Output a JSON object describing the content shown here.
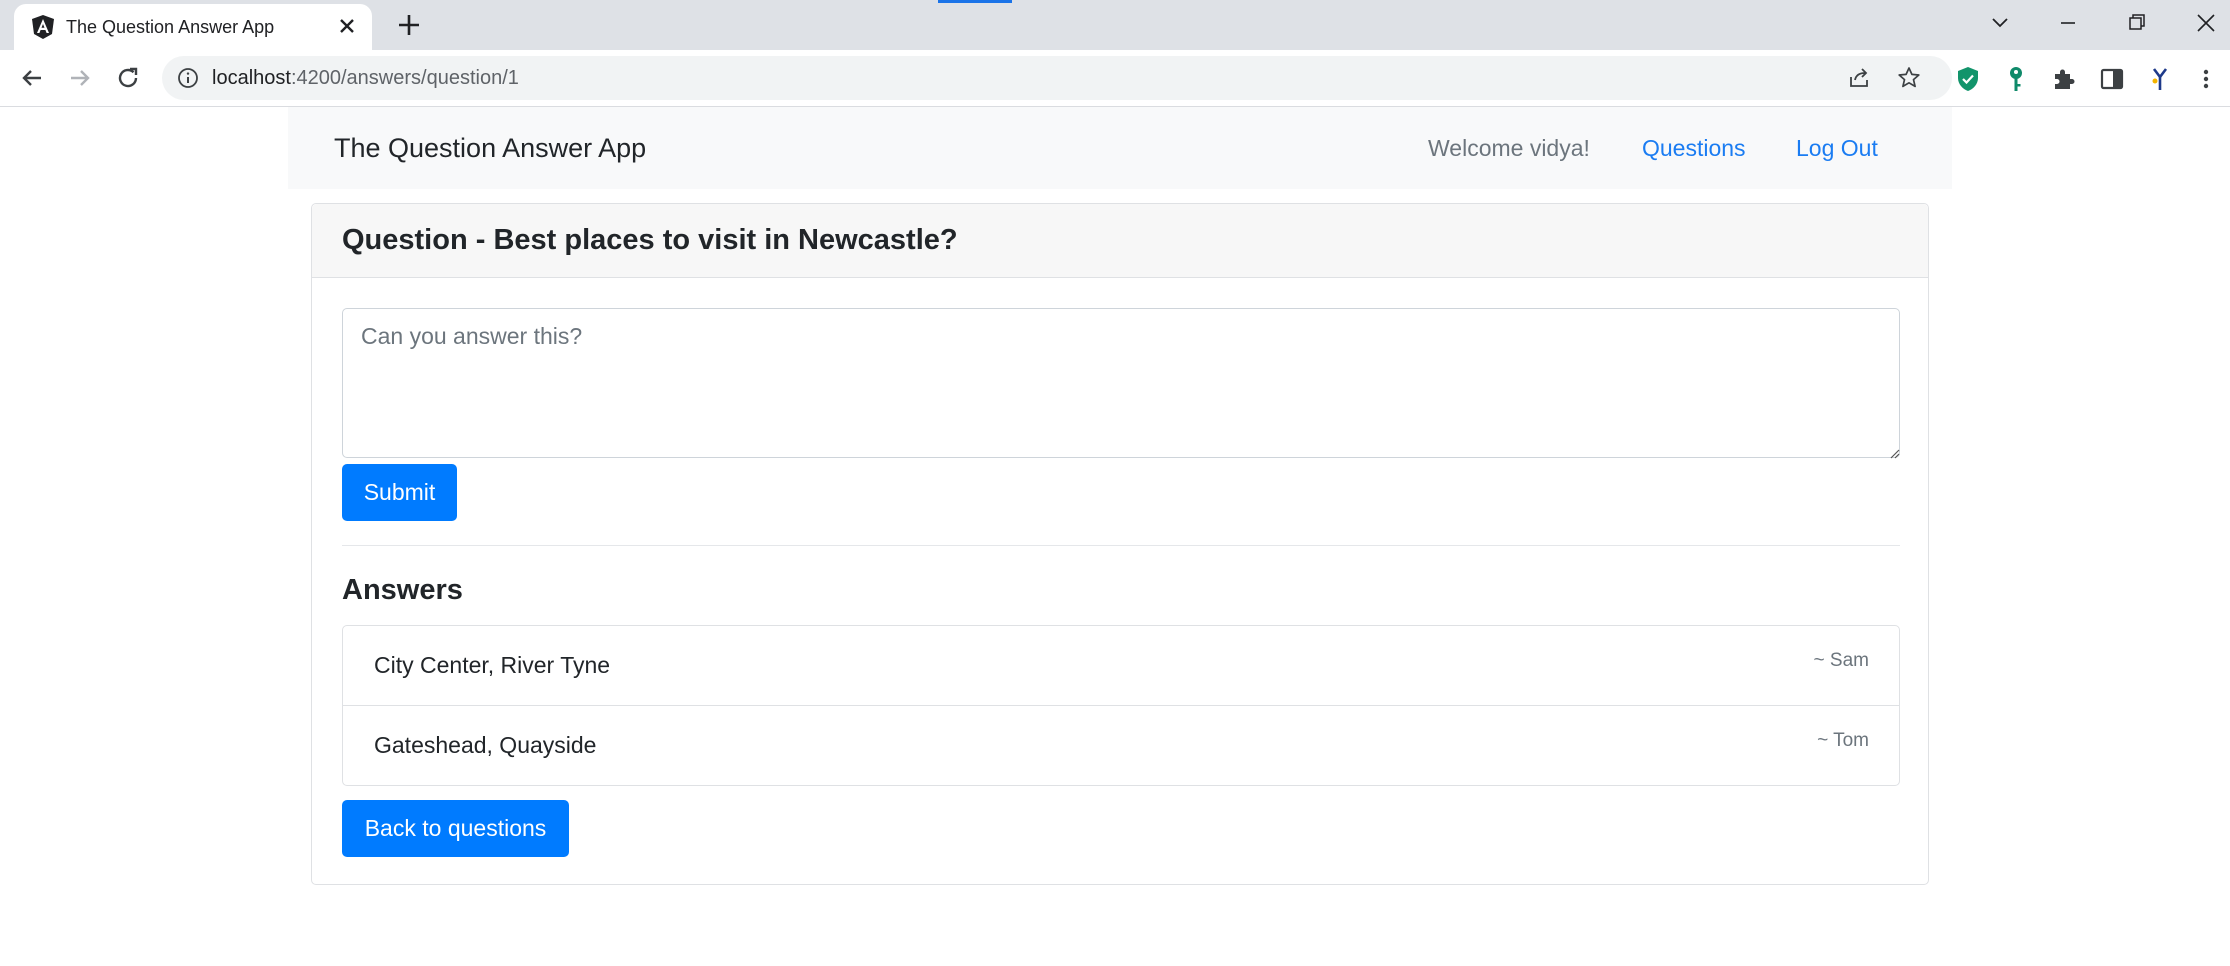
{
  "browser": {
    "tab_title": "The Question Answer App",
    "url_host": "localhost",
    "url_path": ":4200/answers/question/1",
    "accent_color": "#1a73e8"
  },
  "navbar": {
    "brand": "The Question Answer App",
    "welcome": "Welcome vidya!",
    "links": [
      "Questions",
      "Log Out"
    ],
    "link_color": "#1a7cf2"
  },
  "question": {
    "title": "Question - Best places to visit in Newcastle?",
    "answer_placeholder": "Can you answer this?",
    "submit_label": "Submit"
  },
  "answers": {
    "heading": "Answers",
    "items": [
      {
        "text": "City Center, River Tyne",
        "author": "~ Sam"
      },
      {
        "text": "Gateshead, Quayside",
        "author": "~ Tom"
      }
    ]
  },
  "back_label": "Back to questions",
  "colors": {
    "primary_button": "#007bff",
    "navbar_bg": "#f8f9fa"
  },
  "icons": [
    "angular-icon",
    "close-icon",
    "plus-icon",
    "back-arrow-icon",
    "forward-arrow-icon",
    "reload-icon",
    "info-icon",
    "share-icon",
    "star-icon",
    "shield-extension-icon",
    "key-extension-icon",
    "puzzle-icon",
    "side-panel-icon",
    "profile-extension-icon",
    "more-vert-icon"
  ]
}
